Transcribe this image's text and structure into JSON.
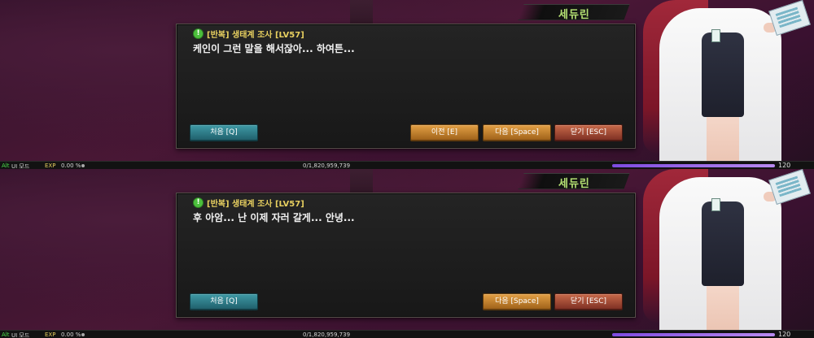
{
  "scenes": [
    {
      "speaker": "세듀린",
      "quest_title": "[반복] 생태계 조사 [LV57]",
      "dialog": "케인이 그런 말을 해서잖아... 하여튼...",
      "buttons": {
        "first": "처음 [Q]",
        "prev": "이전 [E]",
        "next": "다음 [Space]",
        "close": "닫기 [ESC]"
      },
      "status": {
        "alt": "Alt",
        "ui_mode": "UI 모드",
        "exp_label": "EXP",
        "exp_percent": "0.00 %",
        "exp_value": "0/1,820,959,739",
        "level": "120"
      }
    },
    {
      "speaker": "세듀린",
      "quest_title": "[반복] 생태계 조사 [LV57]",
      "dialog": "후 아암... 난 이제 자러 갈게... 안녕...",
      "buttons": {
        "first": "처음 [Q]",
        "next": "다음 [Space]",
        "close": "닫기 [ESC]"
      },
      "status": {
        "alt": "Alt",
        "ui_mode": "UI 모드",
        "exp_label": "EXP",
        "exp_percent": "0.00 %",
        "exp_value": "0/1,820,959,739",
        "level": "120"
      }
    }
  ],
  "icons": {
    "quest": "quest-exclamation-icon"
  },
  "colors": {
    "speaker_name": "#b6e374",
    "quest_title": "#e8d060",
    "button_first": "#2f7c88",
    "button_orange": "#d08a30",
    "button_close": "#a84c36",
    "exp_bar": "#9b6ae8"
  }
}
